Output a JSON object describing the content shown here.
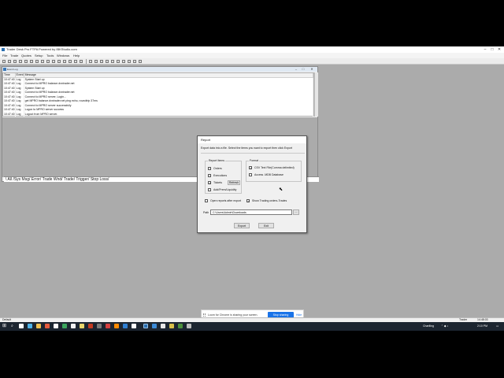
{
  "app": {
    "title": "Trader Desk Pro FTPA Powered by IBKStudio.com",
    "win_controls": [
      "–",
      "□",
      "✕"
    ]
  },
  "menu": [
    "File",
    "Trade",
    "Quotes",
    "Setup",
    "Tools",
    "Windows",
    "Help"
  ],
  "log_window": {
    "title": "Event Log",
    "controls": [
      "–",
      "□",
      "✕"
    ],
    "columns": [
      "Time",
      "Event",
      "Message"
    ],
    "rows": [
      {
        "time": "10:47:40",
        "event": "Log",
        "message": "System Start up"
      },
      {
        "time": "10:47:40",
        "event": "Log",
        "message": "Connect to MPRO balance.dxxtrader.net"
      },
      {
        "time": "10:47:40",
        "event": "Log",
        "message": "System Start up"
      },
      {
        "time": "10:47:40",
        "event": "Log",
        "message": "Connect to MPRO balance.dxxtrader.net"
      },
      {
        "time": "10:47:40",
        "event": "Log",
        "message": "Connect to MPRO server, Login..."
      },
      {
        "time": "10:47:40",
        "event": "Log",
        "message": "get MPRO balance.dxxtrader.net ping echo, roundtrip 37ms"
      },
      {
        "time": "10:47:40",
        "event": "Log",
        "message": "Connect to MPRO server successfully"
      },
      {
        "time": "10:47:40",
        "event": "Log",
        "message": "Logon to MPRO server success"
      },
      {
        "time": "10:47:40",
        "event": "Log",
        "message": "Logout from MPRO server."
      }
    ],
    "tabs_text": "\\ All /Sys Msg/ Error/ Trade Wnd/ Trade/ Trigger/ Stop Loss/"
  },
  "report_dialog": {
    "title": "Report",
    "description": "Export data into a file. Select the items you want to export then click Export",
    "report_items_label": "Report Items",
    "items": [
      {
        "label": "Orders",
        "checked": false
      },
      {
        "label": "Executions",
        "checked": false
      },
      {
        "label": "Tickets",
        "checked": true
      },
      {
        "label": "Add/Prem/Liquidity",
        "checked": false
      }
    ],
    "refresh_label": "Refresh",
    "format_label": "Format",
    "formats": [
      {
        "label": "CSV Text File(Comma delimited)",
        "checked": true
      },
      {
        "label": "Access .MDB Database",
        "checked": false
      }
    ],
    "open_reports_label": "Open reports after export",
    "open_reports_checked": false,
    "show_trading_label": "Show Trading orders-Trades",
    "show_trading_checked": true,
    "path_label": "Path",
    "path_value": "C:\\Users\\Admin\\Downloads",
    "browse_label": "...",
    "export_label": "Export",
    "exit_label": "Exit"
  },
  "share_bar": {
    "message": "Loom for Chrome is sharing your screen.",
    "stop_label": "Stop sharing",
    "hide_label": "Hide"
  },
  "status": {
    "left": "Default",
    "right1": "Trader",
    "right2": "14:48:03"
  },
  "tray": {
    "weather": "Chartling",
    "time": "2:10 PM"
  }
}
